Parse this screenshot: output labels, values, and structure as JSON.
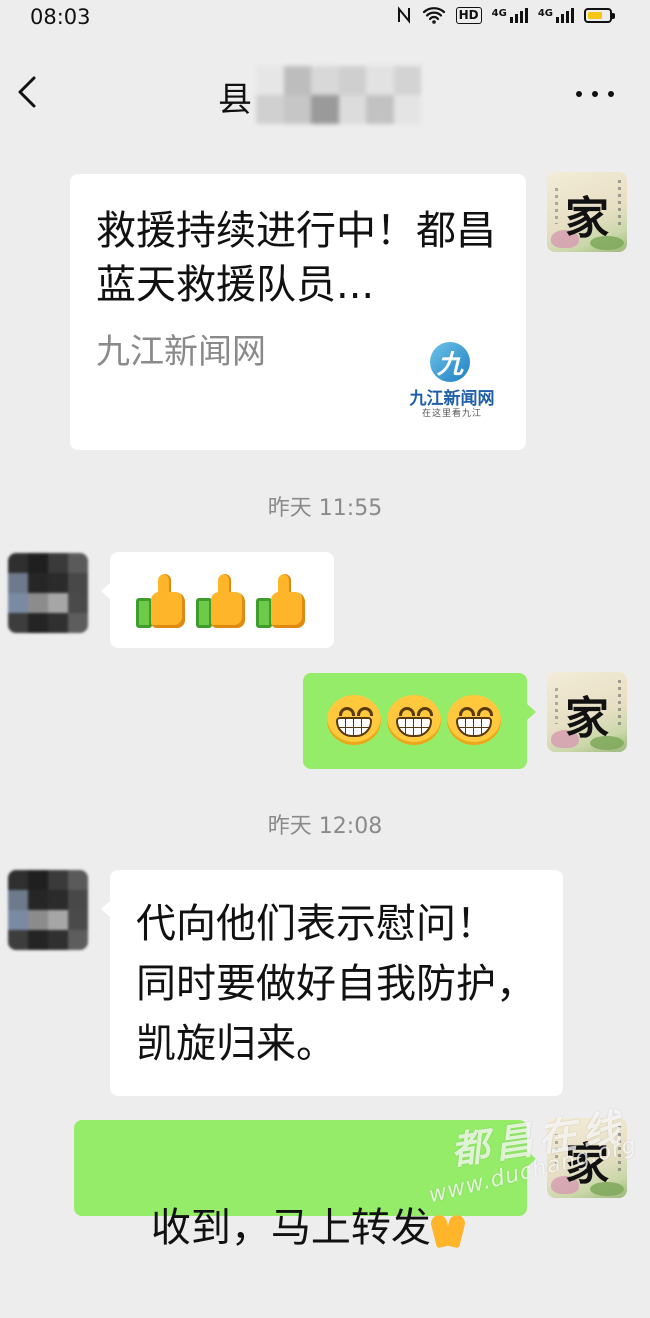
{
  "status_bar": {
    "time": "08:03",
    "network_hd": "HD",
    "network_4g_1": "4G",
    "network_4g_2": "4G"
  },
  "nav": {
    "title_visible": "县",
    "back_icon": "chevron-left-icon",
    "more_icon": "more-dots-icon"
  },
  "messages": {
    "m1": {
      "sender": "me",
      "type": "link-card",
      "title": "救援持续进行中！都昌蓝天救援队员...",
      "source": "九江新闻网",
      "logo_name": "九江新闻网",
      "logo_slogan": "在这里看九江"
    },
    "ts1": "昨天 11:55",
    "m2": {
      "sender": "other",
      "type": "emoji",
      "emojis": [
        "thumbs-up",
        "thumbs-up",
        "thumbs-up"
      ]
    },
    "m3": {
      "sender": "me",
      "type": "emoji",
      "emojis": [
        "grin",
        "grin",
        "grin"
      ]
    },
    "ts2": "昨天 12:08",
    "m4": {
      "sender": "other",
      "type": "text",
      "text": "代向他们表示慰问！\n同时要做好自我防护，\n凯旋归来。"
    },
    "m5": {
      "sender": "me",
      "type": "text",
      "text": "收到，马上转发",
      "emoji": "folded-hands"
    }
  },
  "avatar_me": {
    "char": "家"
  },
  "watermark": {
    "name": "都昌在线",
    "url": "www.duchang.org"
  },
  "colors": {
    "background": "#ededed",
    "bubble_me": "#95ec69",
    "bubble_other": "#ffffff",
    "timestamp": "#8a8a8a"
  }
}
